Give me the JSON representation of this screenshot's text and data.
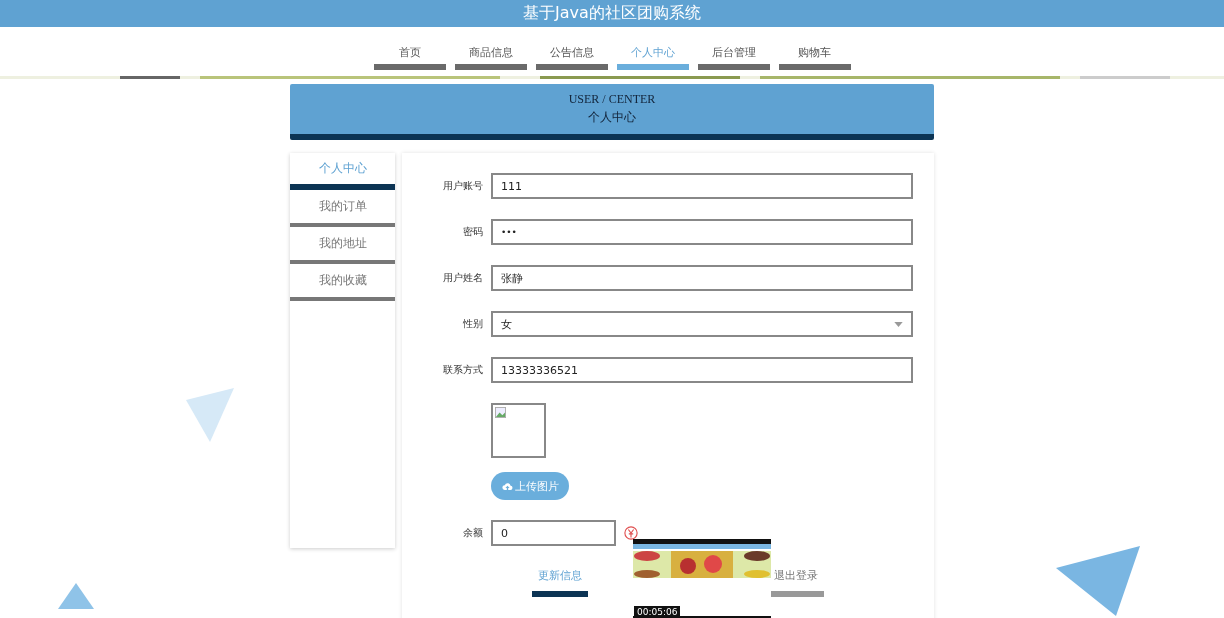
{
  "site_title": "基于Java的社区团购系统",
  "nav": [
    {
      "label": "首页",
      "selected": false
    },
    {
      "label": "商品信息",
      "selected": false
    },
    {
      "label": "公告信息",
      "selected": false
    },
    {
      "label": "个人中心",
      "selected": true
    },
    {
      "label": "后台管理",
      "selected": false
    },
    {
      "label": "购物车",
      "selected": false
    }
  ],
  "header": {
    "title_en": "USER / CENTER",
    "title": "个人中心"
  },
  "sidebar": {
    "items": [
      {
        "label": "个人中心",
        "selected": true
      },
      {
        "label": "我的订单",
        "selected": false
      },
      {
        "label": "我的地址",
        "selected": false
      },
      {
        "label": "我的收藏",
        "selected": false
      }
    ]
  },
  "form": {
    "fields": [
      {
        "kind": "text",
        "label": "用户账号",
        "value": "111"
      },
      {
        "kind": "password",
        "label": "密码",
        "value": "•••"
      },
      {
        "kind": "text",
        "label": "用户姓名",
        "value": "张静"
      },
      {
        "kind": "select",
        "label": "性别",
        "value": "女"
      },
      {
        "kind": "text",
        "label": "联系方式",
        "value": "13333336521"
      }
    ],
    "upload_button": "上传图片",
    "balance": {
      "label": "余额",
      "value": "0"
    },
    "buttons": [
      {
        "label": "更新信息",
        "selected": true
      },
      {
        "label": "退出登录",
        "selected": false
      }
    ]
  },
  "video_preview": {
    "kind": "picture",
    "time": "00:05:06"
  }
}
